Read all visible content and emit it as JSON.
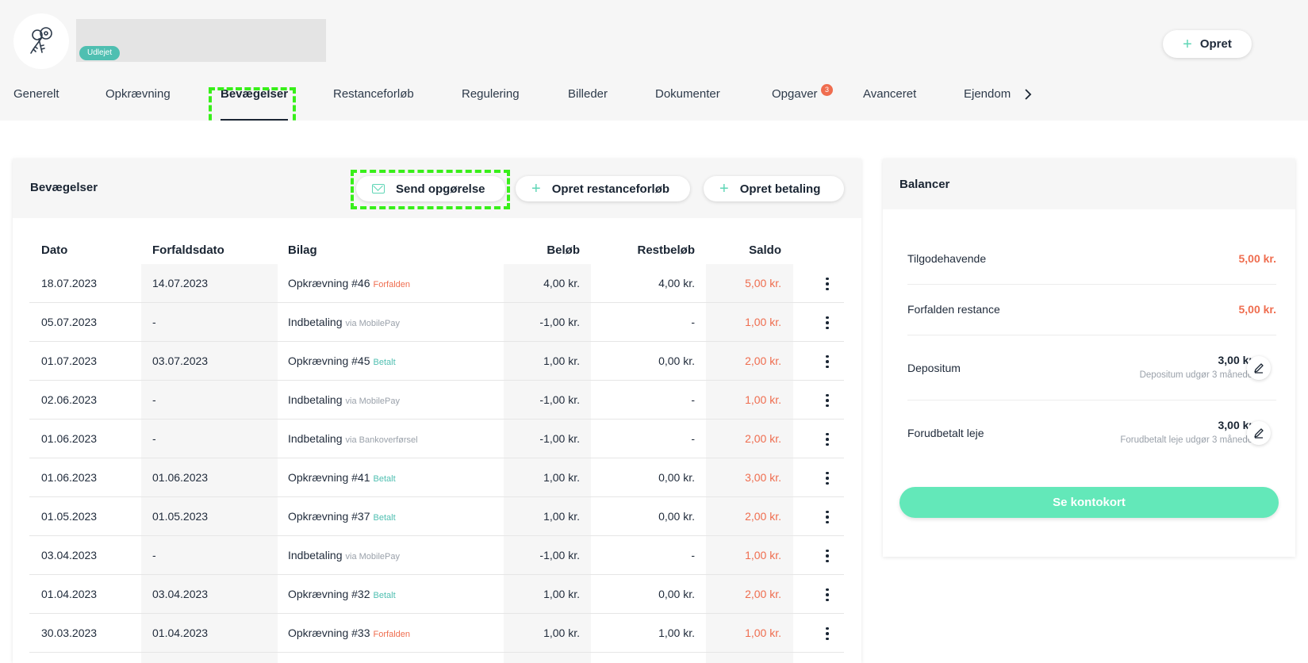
{
  "header": {
    "status_badge": "Udlejet",
    "create_button": "Opret"
  },
  "tabs": [
    {
      "label": "Generelt"
    },
    {
      "label": "Opkrævning"
    },
    {
      "label": "Bevægelser",
      "active": true
    },
    {
      "label": "Restanceforløb"
    },
    {
      "label": "Regulering"
    },
    {
      "label": "Billeder"
    },
    {
      "label": "Dokumenter"
    },
    {
      "label": "Opgaver",
      "badge": "3"
    },
    {
      "label": "Avanceret"
    },
    {
      "label": "Ejendom"
    }
  ],
  "movements": {
    "title": "Bevægelser",
    "buttons": {
      "send_statement": "Send opgørelse",
      "create_arrears": "Opret restanceforløb",
      "create_payment": "Opret betaling"
    },
    "columns": [
      "Dato",
      "Forfaldsdato",
      "Bilag",
      "Beløb",
      "Restbeløb",
      "Saldo"
    ],
    "rows": [
      {
        "date": "18.07.2023",
        "due": "14.07.2023",
        "doc": "Opkrævning #46",
        "note": "Forfalden",
        "note_type": "overdue",
        "amount": "4,00 kr.",
        "rest": "4,00 kr.",
        "saldo": "5,00 kr."
      },
      {
        "date": "05.07.2023",
        "due": "-",
        "doc": "Indbetaling",
        "note": "via MobilePay",
        "note_type": "via",
        "amount": "-1,00 kr.",
        "rest": "-",
        "saldo": "1,00 kr."
      },
      {
        "date": "01.07.2023",
        "due": "03.07.2023",
        "doc": "Opkrævning #45",
        "note": "Betalt",
        "note_type": "paid",
        "amount": "1,00 kr.",
        "rest": "0,00 kr.",
        "saldo": "2,00 kr."
      },
      {
        "date": "02.06.2023",
        "due": "-",
        "doc": "Indbetaling",
        "note": "via MobilePay",
        "note_type": "via",
        "amount": "-1,00 kr.",
        "rest": "-",
        "saldo": "1,00 kr."
      },
      {
        "date": "01.06.2023",
        "due": "-",
        "doc": "Indbetaling",
        "note": "via Bankoverførsel",
        "note_type": "via",
        "amount": "-1,00 kr.",
        "rest": "-",
        "saldo": "2,00 kr."
      },
      {
        "date": "01.06.2023",
        "due": "01.06.2023",
        "doc": "Opkrævning #41",
        "note": "Betalt",
        "note_type": "paid",
        "amount": "1,00 kr.",
        "rest": "0,00 kr.",
        "saldo": "3,00 kr."
      },
      {
        "date": "01.05.2023",
        "due": "01.05.2023",
        "doc": "Opkrævning #37",
        "note": "Betalt",
        "note_type": "paid",
        "amount": "1,00 kr.",
        "rest": "0,00 kr.",
        "saldo": "2,00 kr."
      },
      {
        "date": "03.04.2023",
        "due": "-",
        "doc": "Indbetaling",
        "note": "via MobilePay",
        "note_type": "via",
        "amount": "-1,00 kr.",
        "rest": "-",
        "saldo": "1,00 kr."
      },
      {
        "date": "01.04.2023",
        "due": "03.04.2023",
        "doc": "Opkrævning #32",
        "note": "Betalt",
        "note_type": "paid",
        "amount": "1,00 kr.",
        "rest": "0,00 kr.",
        "saldo": "2,00 kr."
      },
      {
        "date": "30.03.2023",
        "due": "01.04.2023",
        "doc": "Opkrævning #33",
        "note": "Forfalden",
        "note_type": "overdue",
        "amount": "1,00 kr.",
        "rest": "1,00 kr.",
        "saldo": "1,00 kr."
      }
    ]
  },
  "balances": {
    "title": "Balancer",
    "receivable_label": "Tilgodehavende",
    "receivable_value": "5,00 kr.",
    "overdue_label": "Forfalden restance",
    "overdue_value": "5,00 kr.",
    "deposit_label": "Depositum",
    "deposit_value": "3,00 kr.",
    "deposit_note": "Depositum udgør 3 måneder",
    "prepaid_label": "Forudbetalt leje",
    "prepaid_value": "3,00 kr.",
    "prepaid_note": "Forudbetalt leje udgør 3 måneder",
    "account_card_button": "Se kontokort"
  },
  "colors": {
    "accent": "#63e8b9",
    "overdue": "#ef6d4f",
    "paid": "#4fbfb1",
    "highlight": "#38ef1a"
  },
  "icons": [
    "keys-icon",
    "plus-icon",
    "mail-icon",
    "chevron-right-icon",
    "more-vertical-icon",
    "pencil-icon"
  ]
}
